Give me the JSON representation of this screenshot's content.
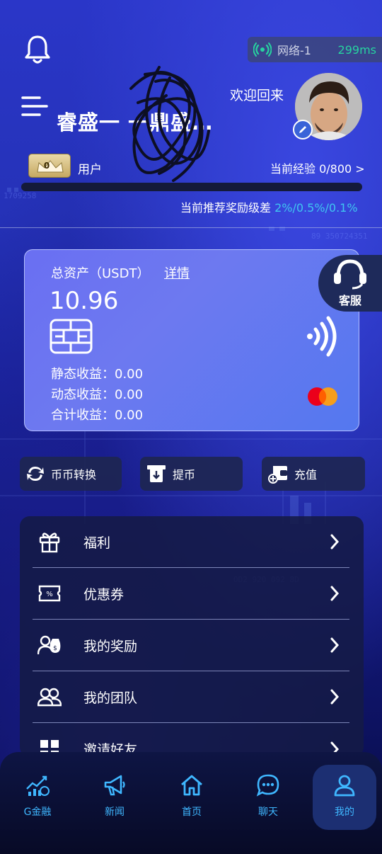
{
  "status": {
    "network_label": "网络-1",
    "latency": "299ms"
  },
  "header": {
    "welcome": "欢迎回来",
    "username": "睿盛一    一鼎盛…",
    "level_badge": "0",
    "user_label": "用户",
    "experience": "当前经验 0/800 >",
    "experience_progress": 0,
    "reward_label": "当前推荐奖励级差 ",
    "reward_values": "2%/0.5%/0.1%"
  },
  "asset_card": {
    "label": "总资产（USDT）",
    "details_link": "详情",
    "total": "10.96",
    "static_income": "静态收益：0.00",
    "dynamic_income": "动态收益：0.00",
    "total_income": "合计收益：0.00"
  },
  "customer_service": {
    "label": "客服"
  },
  "quick_actions": [
    {
      "label": "币币转换",
      "icon": "exchange-icon"
    },
    {
      "label": "提币",
      "icon": "withdraw-icon"
    },
    {
      "label": "充值",
      "icon": "deposit-wallet-icon"
    }
  ],
  "menu": [
    {
      "label": "福利",
      "icon": "gift-icon"
    },
    {
      "label": "优惠券",
      "icon": "coupon-icon"
    },
    {
      "label": "我的奖励",
      "icon": "reward-icon"
    },
    {
      "label": "我的团队",
      "icon": "team-icon"
    },
    {
      "label": "邀请好友",
      "icon": "invite-icon"
    }
  ],
  "tabs": [
    {
      "label": "G金融",
      "icon": "finance-chart-icon"
    },
    {
      "label": "新闻",
      "icon": "megaphone-icon"
    },
    {
      "label": "首页",
      "icon": "home-icon"
    },
    {
      "label": "聊天",
      "icon": "chat-icon"
    },
    {
      "label": "我的",
      "icon": "user-icon",
      "active": true
    }
  ],
  "colors": {
    "accent": "#3fb7ff",
    "latency": "#27d3a0",
    "card": "#6a6ff2",
    "reward": "#3fc6f0"
  }
}
